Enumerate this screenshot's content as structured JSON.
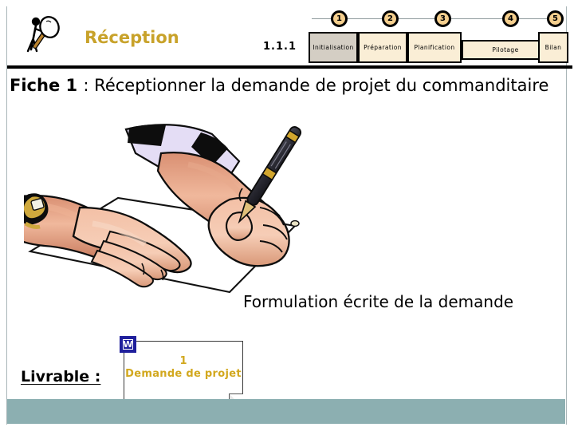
{
  "slide": {
    "accent_gold": "#c8a22a",
    "teal_bar": "#8cafb1",
    "step_fill": "#faeed6",
    "step_active_fill": "#d4cec4",
    "number_badge_fill": "#f5cf8e"
  },
  "header": {
    "logo_icon": "magnifier-person-icon",
    "phase_title": "Réception",
    "code": "1.1.1",
    "steps": [
      {
        "number": "1",
        "label": "Initialisation",
        "active": true
      },
      {
        "number": "2",
        "label": "Préparation",
        "active": false
      },
      {
        "number": "3",
        "label": "Planification",
        "active": false
      },
      {
        "number": "4",
        "label": "Pilotage",
        "active": false
      },
      {
        "number": "5",
        "label": "Bilan",
        "active": false
      }
    ]
  },
  "title": {
    "prefix": "Fiche 1 ",
    "rest": ": Réceptionner la demande de projet du commanditaire"
  },
  "illustration": {
    "icon": "hands-writing-on-paper-illustration",
    "description": "Mains écrivant au stylo sur une feuille de papier"
  },
  "caption": "Formulation écrite de la demande",
  "footer": {
    "livrable_label": "Livrable  :",
    "document": {
      "app_icon": "microsoft-word-icon",
      "app_letter": "W",
      "number": "1",
      "name": "Demande de projet"
    }
  }
}
